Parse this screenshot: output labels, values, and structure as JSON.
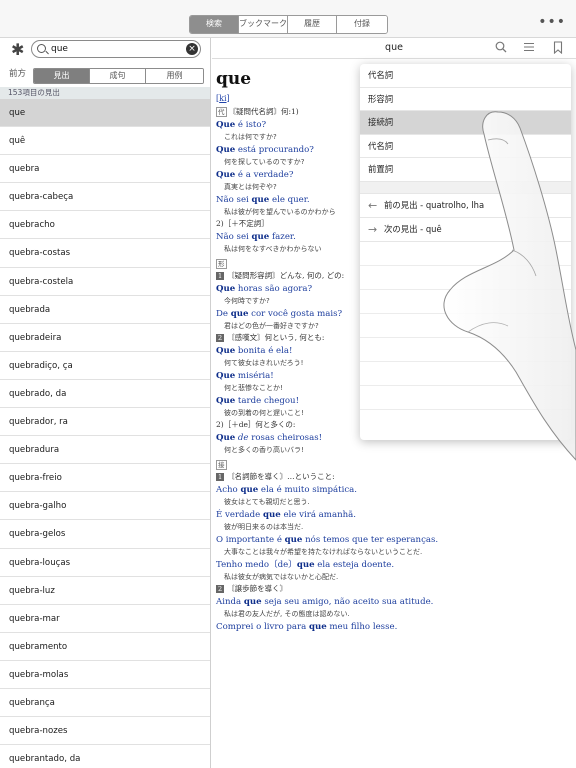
{
  "topbar": {
    "tabs": [
      "検索",
      "ブックマーク",
      "履歴",
      "付録"
    ],
    "active_tab": "検索",
    "more_label": "•••"
  },
  "search": {
    "value": "que",
    "direction_label": "前方",
    "modes": [
      "見出",
      "成句",
      "用例"
    ],
    "active_mode": "見出",
    "result_count": "153項目の見出"
  },
  "results": [
    "que",
    "quê",
    "quebra",
    "quebra-cabeça",
    "quebracho",
    "quebra-costas",
    "quebra-costela",
    "quebrada",
    "quebradeira",
    "quebradiço, ça",
    "quebrado, da",
    "quebrador, ra",
    "quebradura",
    "quebra-freio",
    "quebra-galho",
    "quebra-gelos",
    "quebra-louças",
    "quebra-luz",
    "quebra-mar",
    "quebramento",
    "quebra-molas",
    "quebrança",
    "quebra-nozes",
    "quebrantado, da"
  ],
  "entry": {
    "header_title": "que",
    "headword": "que",
    "pron": "ki",
    "sec1_tag": "代",
    "sec1_def": "〘疑問代名詞〙何:1)",
    "ex1": {
      "pre": "",
      "bold": "Que",
      "post": " é isto?",
      "tr": "これは何ですか?"
    },
    "ex2": {
      "pre": "",
      "bold": "Que",
      "post": " está procurando?",
      "tr": "何を探しているのですか?"
    },
    "ex3": {
      "pre": "",
      "bold": "Que",
      "post": " é a verdade?",
      "tr": "真実とは何ぞや?"
    },
    "ex4": {
      "pre": "Não sei ",
      "bold": "que",
      "post": " ele quer.",
      "tr": "私は彼が何を望んでいるのかわから"
    },
    "sec1_def2": "2)［＋不定詞］",
    "ex5": {
      "pre": "Não sei ",
      "bold": "que",
      "post": " fazer.",
      "tr": "私は何をなすべきかわからない"
    },
    "sec2_tag": "形",
    "sec2_num": "1",
    "sec2_def": "〘疑問形容詞〙どんな, 何の, どの:",
    "ex6": {
      "pre": "",
      "bold": "Que",
      "post": " horas são agora?",
      "tr": "今何時ですか?"
    },
    "ex7": {
      "pre": "De ",
      "bold": "que",
      "post": " cor você gosta mais?",
      "tr": "君はどの色が一番好きですか?"
    },
    "sec2_num2": "2",
    "sec2_def2": "〘感嘆文〙何という, 何とも:",
    "ex8": {
      "pre": "",
      "bold": "Que",
      "post": " bonita é ela!",
      "tr": "何て彼女はきれいだろう!"
    },
    "ex9": {
      "pre": "",
      "bold": "Que",
      "post": " miséria!",
      "tr": "何と悲惨なことか!"
    },
    "ex10": {
      "pre": "",
      "bold": "Que",
      "post": " tarde chegou!",
      "tr": "彼の到着の何と遅いこと!"
    },
    "sec2_def3": "2)［＋de］何と多くの:",
    "ex11": {
      "pre": "",
      "bold": "Que",
      "mid": " de",
      "post": " rosas cheirosas!",
      "tr": "何と多くの香り高いバラ!"
    },
    "sec3_tag": "接",
    "sec3_num": "1",
    "sec3_def": "〘名詞節を導く〙…ということ:",
    "ex12": {
      "pre": "Acho ",
      "bold": "que",
      "post": " ela é muito simpática.",
      "tr": "彼女はとても親切だと思う."
    },
    "ex13": {
      "pre": "É verdade ",
      "bold": "que",
      "post": " ele virá amanhã.",
      "tr": "彼が明日来るのは本当だ."
    },
    "ex14": {
      "pre": "O importante é ",
      "bold": "que",
      "post": " nós temos que ter esperanças.",
      "tr": "大事なことは我々が希望を持たなければならないということだ."
    },
    "ex15": {
      "pre": "Tenho medo〔de〕",
      "bold": "que",
      "post": " ela esteja doente.",
      "tr": "私は彼女が病気ではないかと心配だ."
    },
    "sec3_num2": "2",
    "sec3_def2": "〘譲歩節を導く〙",
    "ex16": {
      "pre": "Ainda ",
      "bold": "que",
      "post": " seja seu amigo, não aceito sua atitude.",
      "tr": "私は君の友人だが, その態度は認めない."
    },
    "ex17": {
      "pre": "Comprei o livro para ",
      "bold": "que",
      "post": " meu filho lesse."
    }
  },
  "popup": {
    "items": [
      "代名詞",
      "形容詞",
      "接続詞",
      "代名詞",
      "前置詞"
    ],
    "highlighted": "接続詞",
    "prev": "前の見出 - quatrolho, lha",
    "next": "次の見出 - quê"
  }
}
